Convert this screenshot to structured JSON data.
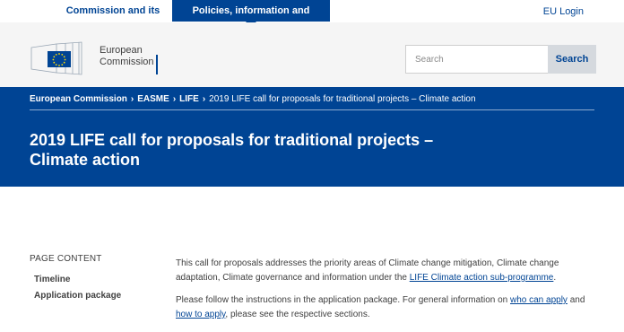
{
  "topbar": {
    "tab_priorities": "Commission and its priorities",
    "tab_policies": "Policies, information and services",
    "login": "EU Login"
  },
  "header": {
    "logo_line1": "European",
    "logo_line2": "Commission",
    "search_placeholder": "Search",
    "search_button": "Search"
  },
  "breadcrumb": {
    "items": [
      "European Commission",
      "EASME",
      "LIFE"
    ],
    "current": "2019 LIFE call for proposals for traditional projects – Climate action"
  },
  "page_title": "2019 LIFE call for proposals for traditional projects – Climate action",
  "page_content": {
    "heading": "PAGE CONTENT",
    "items": [
      "Timeline",
      "Application package"
    ]
  },
  "body": {
    "p1_text": "This call for proposals addresses the priority areas of Climate change mitigation, Climate change adaptation, Climate governance and information under the ",
    "p1_link": "LIFE Climate action sub-programme",
    "p1_end": ".",
    "p2_text": "Please follow the instructions in the application package. For general information on ",
    "p2_link1": "who can apply",
    "p2_mid": " and ",
    "p2_link2": "how to apply",
    "p2_end": ", please see the respective sections."
  },
  "colors": {
    "brand_blue": "#004494",
    "eu_star_yellow": "#ffdd00"
  }
}
